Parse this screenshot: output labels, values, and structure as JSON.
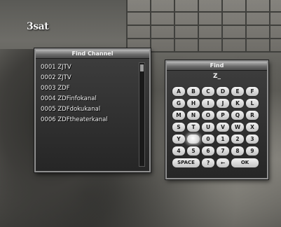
{
  "channel_logo": "3sat",
  "find_channel": {
    "title": "Find Channel",
    "channels": [
      "0001 ZJTV",
      "0002 ZJTV",
      "0003 ZDF",
      "0004 ZDFinfokanal",
      "0005 ZDFdokukanal",
      "0006 ZDFtheaterkanal"
    ]
  },
  "find_dialog": {
    "title": "Find",
    "search_text": "Z_",
    "keys": {
      "k0": "A",
      "k1": "B",
      "k2": "C",
      "k3": "D",
      "k4": "E",
      "k5": "F",
      "k6": "G",
      "k7": "H",
      "k8": "I",
      "k9": "J",
      "k10": "K",
      "k11": "L",
      "k12": "M",
      "k13": "N",
      "k14": "O",
      "k15": "P",
      "k16": "Q",
      "k17": "R",
      "k18": "S",
      "k19": "T",
      "k20": "U",
      "k21": "V",
      "k22": "W",
      "k23": "X",
      "k24": "Y",
      "k25": "",
      "k26": "0",
      "k27": "1",
      "k28": "2",
      "k29": "3",
      "k30": "4",
      "k31": "5",
      "k32": "6",
      "k33": "7",
      "k34": "8",
      "k35": "9",
      "k36": "SPACE",
      "k37": "?",
      "k38": "←",
      "k39": "OK"
    },
    "selected_key": "Z"
  }
}
